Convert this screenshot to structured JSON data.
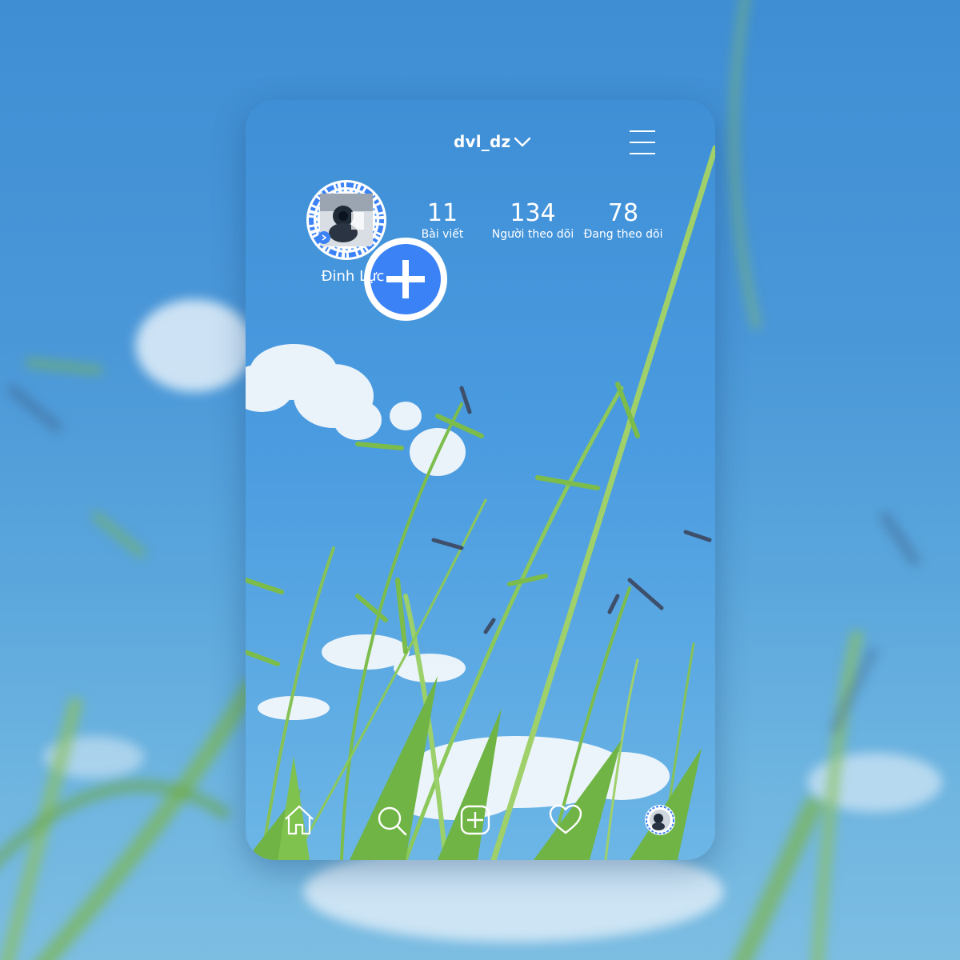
{
  "profile": {
    "username": "dvl_dz",
    "display_name": "Đinh Lực"
  },
  "stats": {
    "posts": {
      "value": "11",
      "label": "Bài viết"
    },
    "followers": {
      "value": "134",
      "label": "Người theo dõi"
    },
    "following": {
      "value": "78",
      "label": "Đang theo dõi"
    }
  },
  "icons": {
    "menu": "hamburger-icon",
    "username_dropdown": "chevron-down-icon",
    "add_story": "plus-circle-icon",
    "nav": [
      "home-icon",
      "search-icon",
      "add-post-icon",
      "heart-icon",
      "profile-avatar"
    ]
  },
  "colors": {
    "accent": "#3b82f6",
    "text": "#ffffff",
    "sky": "#4a97d8",
    "grass": "#7fbf4a"
  }
}
